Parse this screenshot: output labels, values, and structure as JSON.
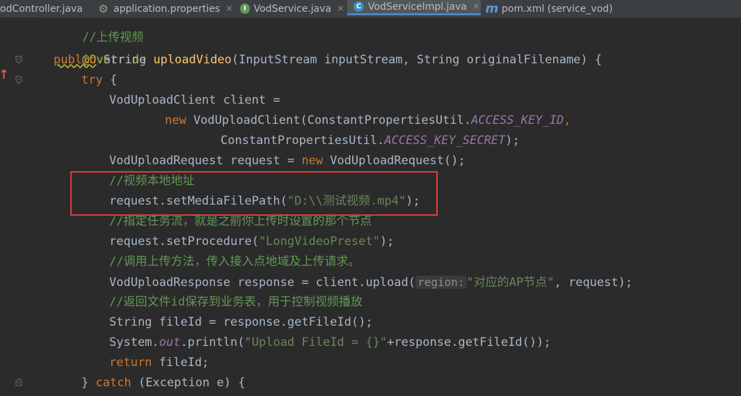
{
  "tabs": [
    {
      "label": "odController.java",
      "icon": "java-class-icon",
      "active": false
    },
    {
      "label": "application.properties",
      "icon": "spring-properties-icon",
      "active": false
    },
    {
      "label": "VodService.java",
      "icon": "java-interface-icon",
      "active": false
    },
    {
      "label": "VodServiceImpl.java",
      "icon": "java-class-icon",
      "active": true
    },
    {
      "label": "pom.xml (service_vod)",
      "icon": "maven-icon",
      "active": false
    }
  ],
  "icons": {
    "interface_letter": "I",
    "class_letter": "C",
    "maven_letter": "m",
    "close": "×"
  },
  "code": {
    "l0": "//上传视频",
    "l1": "@Override",
    "l2_kw": "public",
    "l2_type": " String ",
    "l2_fn": "uploadVideo",
    "l2_rest": "(InputStream inputStream, String originalFilename) {",
    "l3_kw": "try",
    "l3_rest": " {",
    "l4": "VodUploadClient client =",
    "l5_kw": "new",
    "l5_a": " VodUploadClient(ConstantPropertiesUtil.",
    "l5_c": "ACCESS_KEY_ID",
    "l5_b": ",",
    "l6_a": "ConstantPropertiesUtil.",
    "l6_c": "ACCESS_KEY_SECRET",
    "l6_b": ");",
    "l7_a": "VodUploadRequest request = ",
    "l7_kw": "new",
    "l7_b": " VodUploadRequest();",
    "l8": "//视频本地地址",
    "l9_a": "request.setMediaFilePath(",
    "l9_s": "\"D:\\\\测试视频.mp4\"",
    "l9_b": ");",
    "l10": "//指定任务流，就是之前你上传时设置的那个节点",
    "l11_a": "request.setProcedure(",
    "l11_s": "\"LongVideoPreset\"",
    "l11_b": ");",
    "l12": "//调用上传方法，传入接入点地域及上传请求。",
    "l13_a": "VodUploadResponse response = client.upload(",
    "l13_hint": "region:",
    "l13_s": "\"对应的AP节点\"",
    "l13_b": ", request);",
    "l14": "//返回文件id保存到业务表，用于控制视频播放",
    "l15": "String fileId = response.getFileId();",
    "l16_a": "System.",
    "l16_f": "out",
    "l16_b": ".println(",
    "l16_s": "\"Upload FileId = {}\"",
    "l16_c": "+response.getFileId());",
    "l17_kw": "return",
    "l17_b": " fileId;",
    "l18_a": "} ",
    "l18_kw": "catch",
    "l18_b": " (Exception e) {"
  },
  "gutter": {
    "override_marker": "↑"
  }
}
